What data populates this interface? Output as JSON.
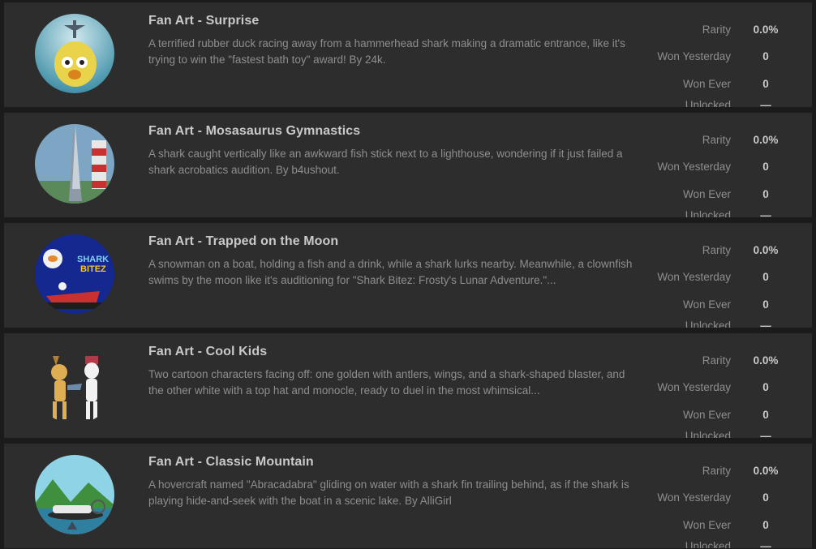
{
  "items": [
    {
      "title": "Fan Art - Surprise",
      "description": "A terrified rubber duck racing away from a hammerhead shark making a dramatic entrance, like it's trying to win the \"fastest bath toy\" award! By 24k.",
      "thumb_icon": "rubber-duck-shark-image",
      "rarity_label": "Rarity",
      "rarity": "0.0%",
      "won_yesterday_label": "Won Yesterday",
      "won_yesterday": "0",
      "won_ever_label": "Won Ever",
      "won_ever": "0",
      "unlocked_label": "Unlocked",
      "unlocked": "—"
    },
    {
      "title": "Fan Art - Mosasaurus Gymnastics",
      "description": "A shark caught vertically like an awkward fish stick next to a lighthouse, wondering if it just failed a shark acrobatics audition. By b4ushout.",
      "thumb_icon": "shark-lighthouse-image",
      "rarity_label": "Rarity",
      "rarity": "0.0%",
      "won_yesterday_label": "Won Yesterday",
      "won_yesterday": "0",
      "won_ever_label": "Won Ever",
      "won_ever": "0",
      "unlocked_label": "Unlocked",
      "unlocked": "—"
    },
    {
      "title": "Fan Art - Trapped on the Moon",
      "description": "A snowman on a boat, holding a fish and a drink, while a shark lurks nearby. Meanwhile, a clownfish swims by the moon like it's auditioning for \"Shark Bitez: Frosty's Lunar Adventure.\"...",
      "thumb_icon": "shark-bitez-moon-image",
      "thumb_text_1": "SHARK",
      "thumb_text_2": "BITEZ",
      "rarity_label": "Rarity",
      "rarity": "0.0%",
      "won_yesterday_label": "Won Yesterday",
      "won_yesterday": "0",
      "won_ever_label": "Won Ever",
      "won_ever": "0",
      "unlocked_label": "Unlocked",
      "unlocked": "—"
    },
    {
      "title": "Fan Art - Cool Kids",
      "description": "Two cartoon characters facing off: one golden with antlers, wings, and a shark-shaped blaster, and the other white with a top hat and monocle, ready to duel in the most whimsical...",
      "thumb_icon": "cartoon-characters-image",
      "rarity_label": "Rarity",
      "rarity": "0.0%",
      "won_yesterday_label": "Won Yesterday",
      "won_yesterday": "0",
      "won_ever_label": "Won Ever",
      "won_ever": "0",
      "unlocked_label": "Unlocked",
      "unlocked": "—"
    },
    {
      "title": "Fan Art - Classic Mountain",
      "description": "A hovercraft named \"Abracadabra\" gliding on water with a shark fin trailing behind, as if the shark is playing hide-and-seek with the boat in a scenic lake. By AlliGirl",
      "thumb_icon": "hovercraft-mountain-image",
      "rarity_label": "Rarity",
      "rarity": "0.0%",
      "won_yesterday_label": "Won Yesterday",
      "won_yesterday": "0",
      "won_ever_label": "Won Ever",
      "won_ever": "0",
      "unlocked_label": "Unlocked",
      "unlocked": "—"
    }
  ]
}
